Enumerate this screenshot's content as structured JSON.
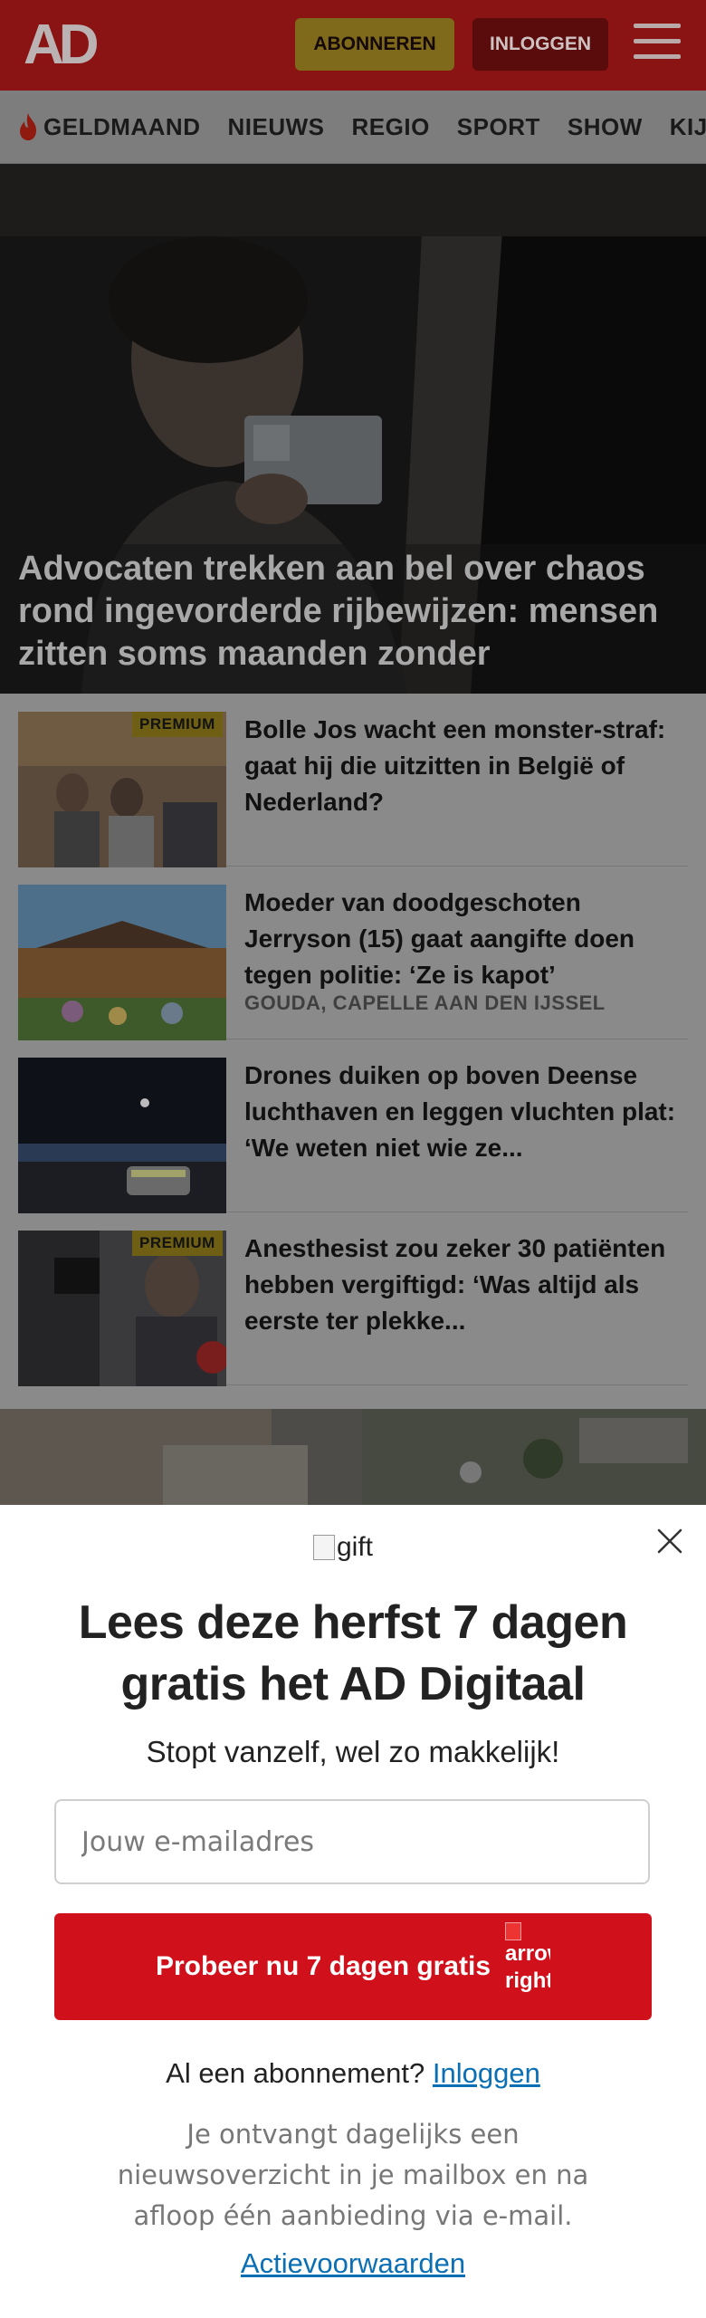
{
  "header": {
    "logo": "AD",
    "subscribe_label": "ABONNEREN",
    "login_label": "INLOGGEN"
  },
  "nav": {
    "items": [
      "GELDMAAND",
      "NIEUWS",
      "REGIO",
      "SPORT",
      "SHOW",
      "KIJK"
    ]
  },
  "hero": {
    "title": "Advocaten trekken aan bel over chaos rond ingevorderde rijbewijzen: mensen zitten soms maanden zonder"
  },
  "articles": [
    {
      "title": "Bolle Jos wacht een monster-straf: gaat hij die uitzitten in België of Nederland?",
      "badge": "PREMIUM",
      "location": ""
    },
    {
      "title": "Moeder van doodgeschoten Jerryson (15) gaat aangifte doen tegen politie: ‘Ze is kapot’",
      "badge": "",
      "location": "GOUDA, CAPELLE AAN DEN IJSSEL"
    },
    {
      "title": "Drones duiken op boven Deense luchthaven en leggen vluchten plat: ‘We weten niet wie ze...",
      "badge": "",
      "location": ""
    },
    {
      "title": "Anesthesist zou zeker 30 patiënten hebben vergiftigd: ‘Was altijd als eerste ter plekke...",
      "badge": "PREMIUM",
      "location": ""
    }
  ],
  "modal": {
    "gift_alt": "gift",
    "title": "Lees deze herfst 7 dagen gratis het AD Digitaal",
    "subtitle": "Stopt vanzelf, wel zo makkelijk!",
    "email_placeholder": "Jouw e-mailadres",
    "cta_label": "Probeer nu 7 dagen gratis",
    "cta_arrow_alt": "arrow right",
    "have_subscription": "Al een abonnement?",
    "login_link": "Inloggen",
    "fine_print": "Je ontvangt dagelijks een nieuwsoverzicht in je mailbox en na afloop één aanbieding via e-mail.",
    "terms": "Actievoorwaarden"
  },
  "colors": {
    "brand_red": "#d0111b",
    "link_blue": "#0a6fb4",
    "premium_gold": "#f2c200"
  }
}
